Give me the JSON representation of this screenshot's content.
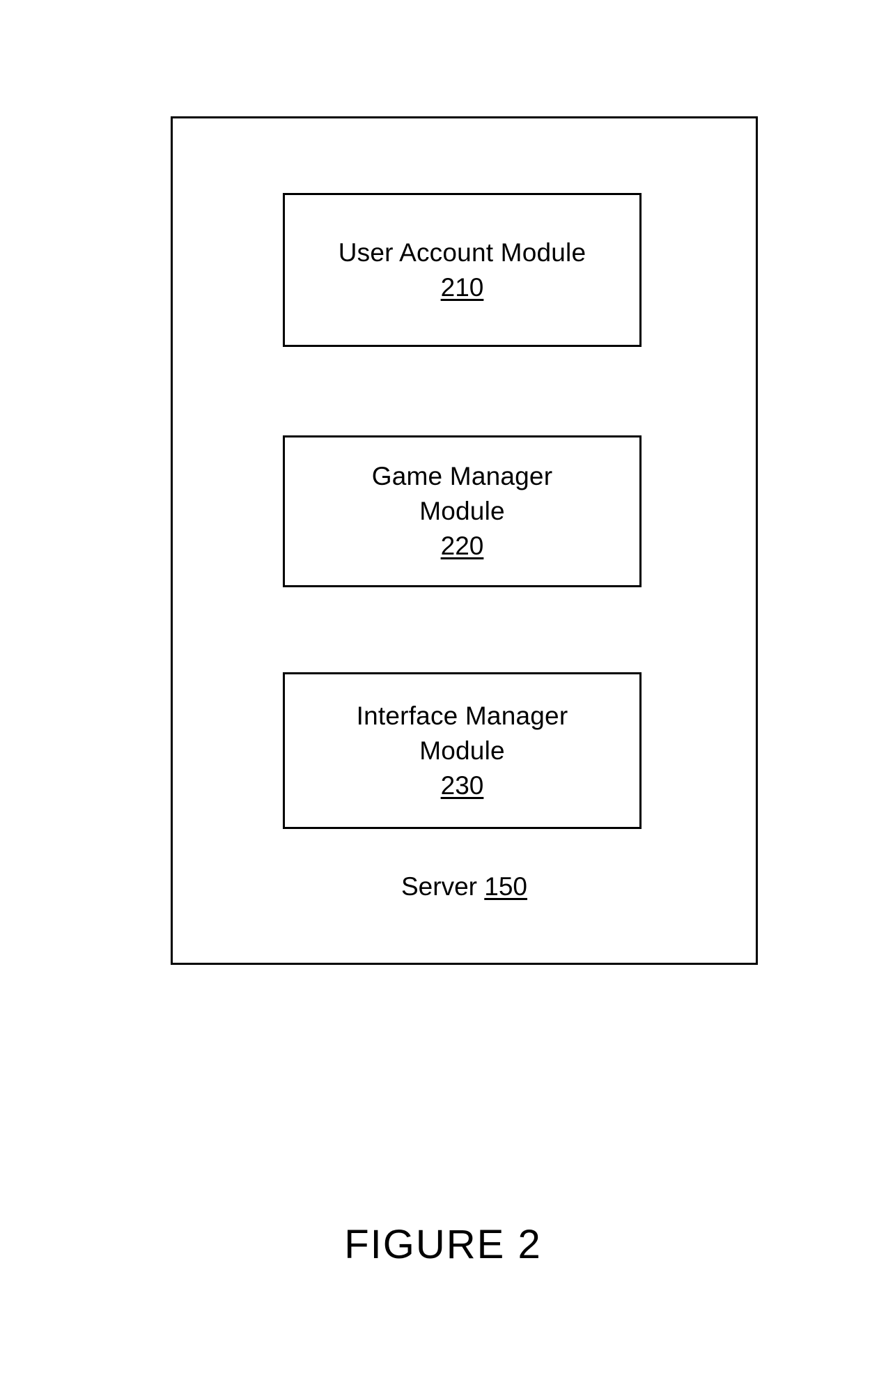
{
  "figure": {
    "caption": "FIGURE 2",
    "container": {
      "label": "Server",
      "reference_numeral": "150"
    },
    "modules": [
      {
        "title": "User Account Module",
        "reference_numeral": "210"
      },
      {
        "title": "Game Manager\nModule",
        "reference_numeral": "220"
      },
      {
        "title": "Interface Manager\nModule",
        "reference_numeral": "230"
      }
    ]
  },
  "colors": {
    "stroke": "#000000",
    "background": "#ffffff",
    "text": "#000000"
  }
}
